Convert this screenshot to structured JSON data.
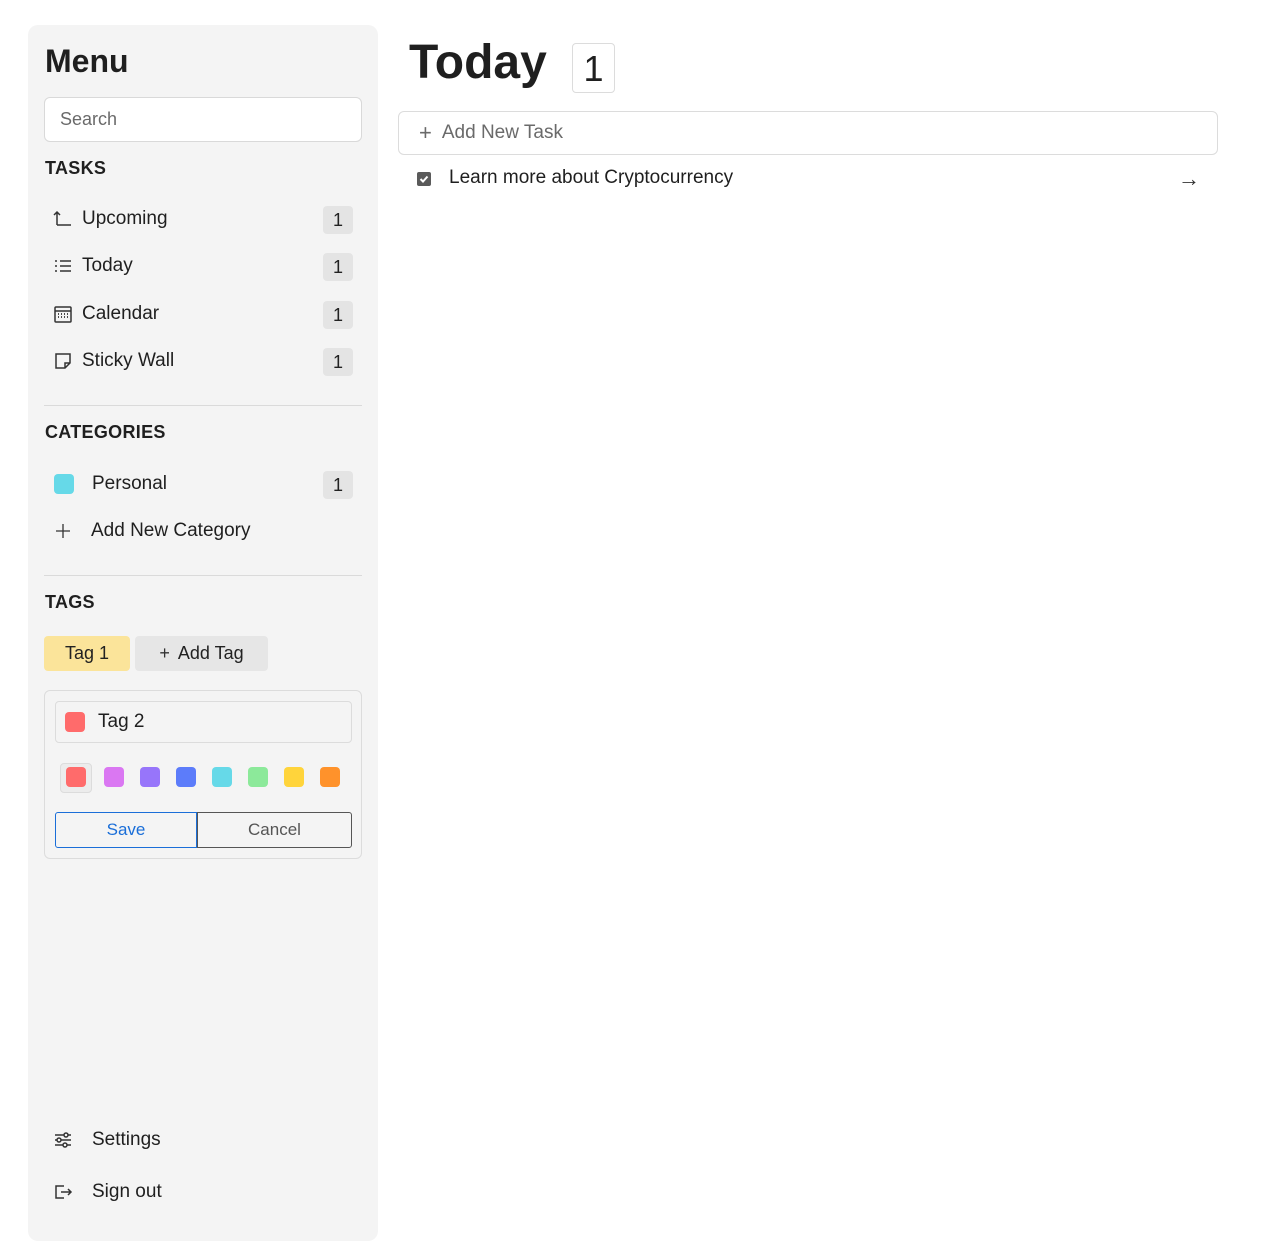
{
  "sidebar": {
    "title": "Menu",
    "search_placeholder": "Search",
    "tasks_heading": "TASKS",
    "tasks": [
      {
        "label": "Upcoming",
        "count": "1",
        "icon": "upcoming-icon"
      },
      {
        "label": "Today",
        "count": "1",
        "icon": "list-icon"
      },
      {
        "label": "Calendar",
        "count": "1",
        "icon": "calendar-icon"
      },
      {
        "label": "Sticky Wall",
        "count": "1",
        "icon": "sticky-note-icon"
      }
    ],
    "categories_heading": "CATEGORIES",
    "categories": [
      {
        "label": "Personal",
        "count": "1",
        "color": "#66d9e8"
      }
    ],
    "add_category_label": "Add New Category",
    "tags_heading": "TAGS",
    "tags": [
      {
        "label": "Tag 1",
        "color": "#fbe49a"
      }
    ],
    "add_tag_label": "Add Tag",
    "tag_editor": {
      "name_value": "Tag 2",
      "selected_color": "#ff6b6b",
      "palette": [
        "#ff6b6b",
        "#da77f2",
        "#9775fa",
        "#5c7cfa",
        "#66d9e8",
        "#8ce99a",
        "#ffd43b",
        "#ff922b"
      ],
      "save_label": "Save",
      "cancel_label": "Cancel"
    },
    "settings_label": "Settings",
    "signout_label": "Sign out"
  },
  "main": {
    "title": "Today",
    "count": "1",
    "add_task_label": "Add New Task",
    "tasks": [
      {
        "label": "Learn more about Cryptocurrency",
        "checked": true
      }
    ]
  },
  "colors": {
    "accent": "#1a6ed8",
    "sidebar_bg": "#f4f4f4"
  }
}
